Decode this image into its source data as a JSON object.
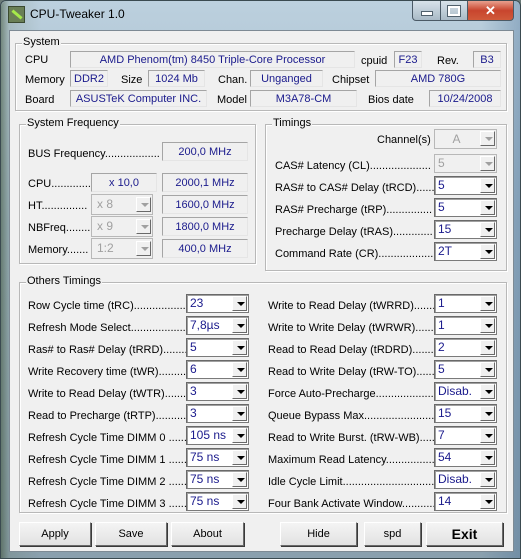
{
  "window": {
    "title": "CPU-Tweaker 1.0",
    "close_glyph": "✕"
  },
  "system": {
    "group_title": "System",
    "cpu_label": "CPU",
    "cpu_value": "AMD Phenom(tm) 8450 Triple-Core Processor",
    "cpuid_label": "cpuid",
    "cpuid_value": "F23",
    "rev_label": "Rev.",
    "rev_value": "B3",
    "memory_label": "Memory",
    "memory_value": "DDR2",
    "size_label": "Size",
    "size_value": "1024 Mb",
    "chan_label": "Chan.",
    "chan_value": "Unganged",
    "chipset_label": "Chipset",
    "chipset_value": "AMD 780G",
    "board_label": "Board",
    "board_value": "ASUSTeK Computer INC.",
    "model_label": "Model",
    "model_value": "M3A78-CM",
    "bios_label": "Bios date",
    "bios_value": "10/24/2008"
  },
  "frequency": {
    "group_title": "System Frequency",
    "bus_label": "BUS Frequency..................",
    "bus_value": "200,0 MHz",
    "rows": [
      {
        "label": "CPU..............",
        "multiplier": "x 10,0",
        "value": "2000,1 MHz"
      },
      {
        "label": "HT...............",
        "multiplier": "x 8",
        "value": "1600,0 MHz"
      },
      {
        "label": "NBFreq.........",
        "multiplier": "x 9",
        "value": "1800,0 MHz"
      },
      {
        "label": "Memory.......",
        "multiplier": "1:2",
        "value": "400,0 MHz"
      }
    ]
  },
  "timings": {
    "group_title": "Timings",
    "channel_label": "Channel(s)",
    "channel_value": "A",
    "rows": [
      {
        "label": "CAS# Latency (CL)....................",
        "value": "5",
        "disabled": true
      },
      {
        "label": "RAS# to CAS# Delay (tRCD).......",
        "value": "5"
      },
      {
        "label": "RAS# Precharge (tRP)...............",
        "value": "5"
      },
      {
        "label": "Precharge Delay (tRAS).............",
        "value": "15"
      },
      {
        "label": "Command Rate (CR)....................",
        "value": "2T"
      }
    ]
  },
  "others": {
    "group_title": "Others Timings",
    "left": [
      {
        "label": "Row Cycle time (tRC)...................",
        "value": "23"
      },
      {
        "label": "Refresh Mode Select....................",
        "value": "7,8µs"
      },
      {
        "label": "Ras# to Ras# Delay (tRRD).........",
        "value": "5"
      },
      {
        "label": "Write Recovery time (tWR)..........",
        "value": "6"
      },
      {
        "label": "Write to Read Delay (tWTR).........",
        "value": "3"
      },
      {
        "label": "Read to Precharge (tRTP)............",
        "value": "3"
      },
      {
        "label": "Refresh Cycle Time  DIMM 0 .......",
        "value": "105 ns"
      },
      {
        "label": "Refresh Cycle Time  DIMM 1 .......",
        "value": "75 ns"
      },
      {
        "label": "Refresh Cycle Time  DIMM 2 .......",
        "value": "75 ns"
      },
      {
        "label": "Refresh Cycle Time  DIMM 3 .......",
        "value": "75 ns"
      }
    ],
    "right": [
      {
        "label": "Write to Read Delay (tWRRD).......",
        "value": "1"
      },
      {
        "label": "Write to Write Delay (tWRWR).......",
        "value": "1"
      },
      {
        "label": "Read to Read Delay (tRDRD).........",
        "value": "2"
      },
      {
        "label": "Read to Write Delay (tRW-TO).......",
        "value": "5"
      },
      {
        "label": "Force Auto-Precharge....................",
        "value": "Disab."
      },
      {
        "label": "Queue Bypass Max........................",
        "value": "15"
      },
      {
        "label": "Read to Write Burst. (tRW-WB)......",
        "value": "7"
      },
      {
        "label": "Maximum Read Latency..................",
        "value": "54"
      },
      {
        "label": "Idle Cycle Limit..............................",
        "value": "Disab."
      },
      {
        "label": "Four Bank Activate Window...........",
        "value": "14"
      }
    ]
  },
  "buttons": {
    "apply": "Apply",
    "save": "Save",
    "about": "About",
    "hide": "Hide",
    "spd": "spd",
    "exit": "Exit"
  }
}
